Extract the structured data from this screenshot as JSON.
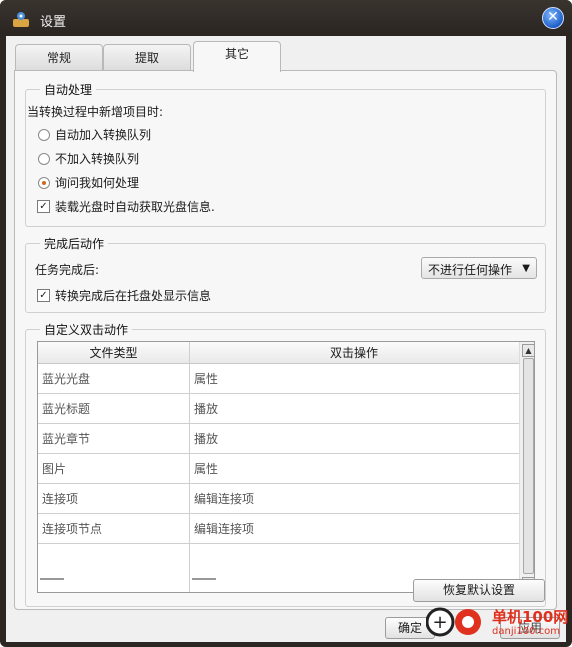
{
  "window": {
    "title": "设置"
  },
  "tabs": [
    {
      "label": "常规",
      "active": false
    },
    {
      "label": "提取",
      "active": false
    },
    {
      "label": "其它",
      "active": true
    }
  ],
  "auto_process": {
    "legend": "自动处理",
    "prompt": "当转换过程中新增项目时:",
    "options": [
      {
        "label": "自动加入转换队列",
        "selected": false
      },
      {
        "label": "不加入转换队列",
        "selected": false
      },
      {
        "label": "询问我如何处理",
        "selected": true
      }
    ],
    "disc_info": {
      "label": "装载光盘时自动获取光盘信息.",
      "checked": true
    }
  },
  "after_complete": {
    "legend": "完成后动作",
    "label": "任务完成后:",
    "select_value": "不进行任何操作",
    "tray_msg": {
      "label": "转换完成后在托盘处显示信息",
      "checked": true
    }
  },
  "dblclick": {
    "legend": "自定义双击动作",
    "columns": [
      "文件类型",
      "双击操作"
    ],
    "rows": [
      [
        "蓝光光盘",
        "属性"
      ],
      [
        "蓝光标题",
        "播放"
      ],
      [
        "蓝光章节",
        "播放"
      ],
      [
        "图片",
        "属性"
      ],
      [
        "连接项",
        "编辑连接项"
      ],
      [
        "连接项节点",
        "编辑连接项"
      ],
      [
        "",
        ""
      ]
    ]
  },
  "buttons": {
    "restore": "恢复默认设置",
    "ok": "确定",
    "apply": "应用"
  },
  "watermark": {
    "text": "单机100网",
    "url": "danji100.com"
  },
  "colors": {
    "title_bg": "#2b2622",
    "accent_radio": "#d2691e",
    "watermark_red": "#e0301e"
  }
}
